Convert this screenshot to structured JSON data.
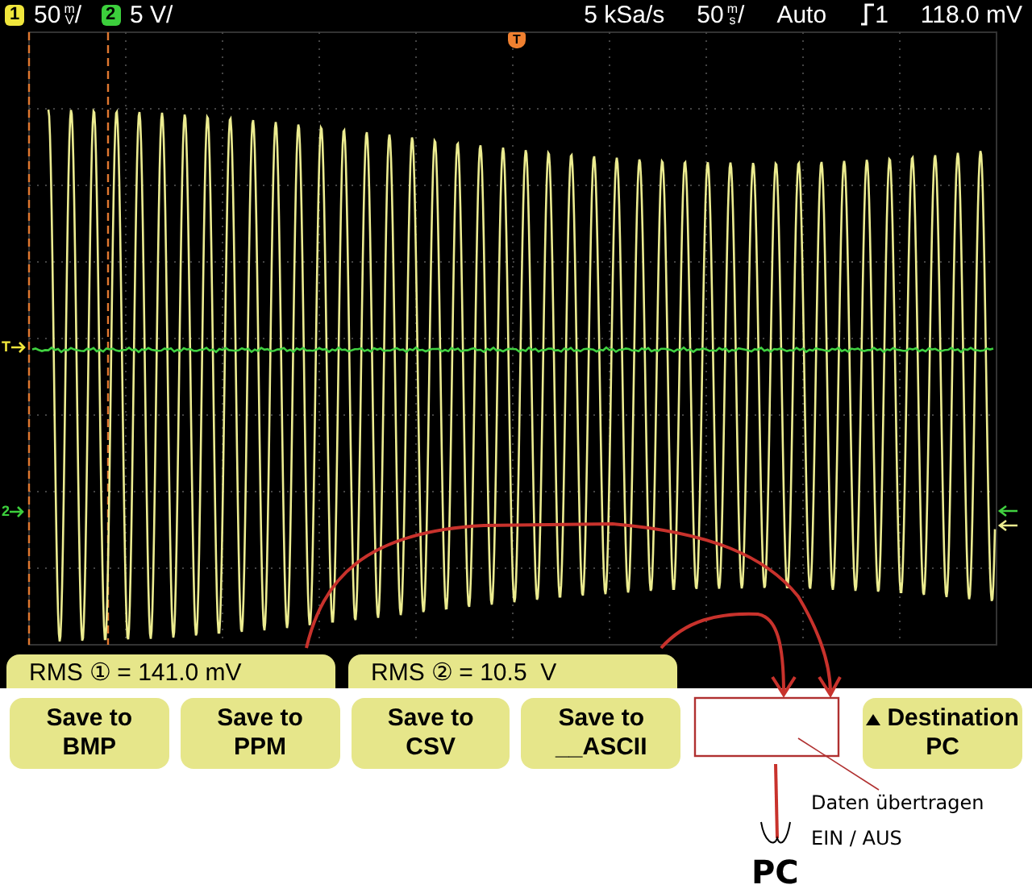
{
  "status_bar": {
    "channels": [
      {
        "badge": "1",
        "color": "#f0e63c",
        "value": "50",
        "unit_top": "m",
        "unit_bottom": "V",
        "suffix": "/"
      },
      {
        "badge": "2",
        "color": "#3ccf3c",
        "value": "5 V/"
      }
    ],
    "sample_rate": "5 kSa/s",
    "timebase": {
      "value": "50",
      "unit_top": "m",
      "unit_bottom": "s",
      "suffix": "/"
    },
    "trigger_mode": "Auto",
    "trigger_source": "1",
    "trigger_level": "118.0 mV"
  },
  "screen": {
    "trigger_marker": "T",
    "left_markers": [
      {
        "label": "T",
        "color": "#f0e63c"
      },
      {
        "label": "2",
        "color": "#3ccf3c"
      }
    ]
  },
  "measurements": [
    {
      "label": "RMS ① = 141.0 mV"
    },
    {
      "label": "RMS ② = 10.5  V"
    }
  ],
  "softkeys": [
    {
      "kind": "save",
      "line1": "Save to",
      "line2": "BMP"
    },
    {
      "kind": "save",
      "line1": "Save to",
      "line2": "PPM"
    },
    {
      "kind": "save",
      "line1": "Save to",
      "line2": "CSV"
    },
    {
      "kind": "save",
      "line1": "Save to",
      "line2": "__ASCII"
    },
    {
      "kind": "blank"
    },
    {
      "kind": "menu",
      "line1": "Destination",
      "line2": "PC"
    }
  ],
  "annotation": {
    "note_line1": "Daten übertragen",
    "note_line2": "EIN / AUS",
    "target": "PC"
  }
}
